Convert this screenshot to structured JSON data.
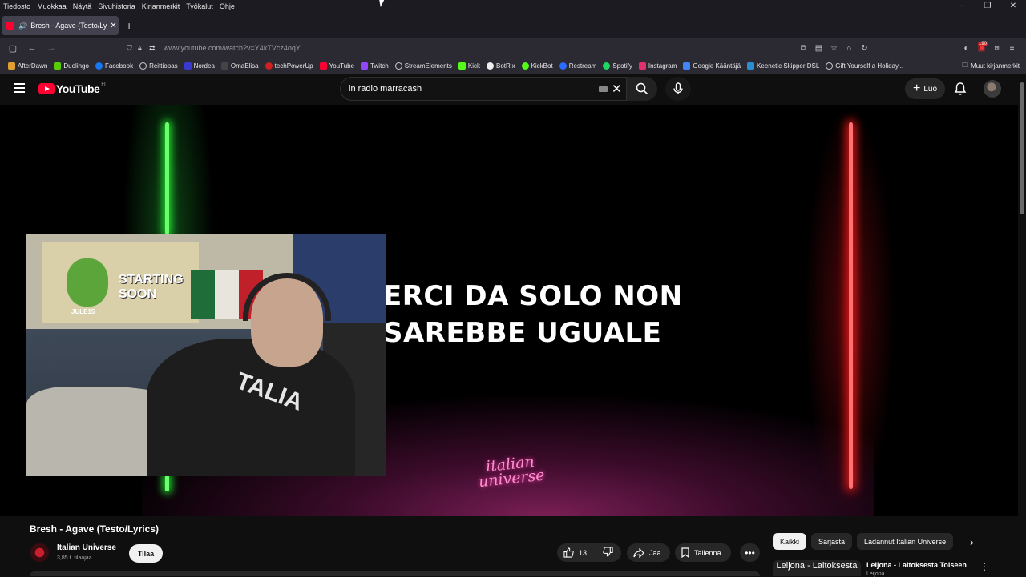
{
  "menubar": {
    "items": [
      "Tiedosto",
      "Muokkaa",
      "Näytä",
      "Sivuhistoria",
      "Kirjanmerkit",
      "Työkalut",
      "Ohje"
    ]
  },
  "tab": {
    "title": "Bresh - Agave (Testo/Lyrics)"
  },
  "urlbar": {
    "url": "www.youtube.com/watch?v=Y4kTVcz4oqY"
  },
  "badges": {
    "extension_count": "190"
  },
  "bookmarks": {
    "items": [
      {
        "label": "AfterDawn",
        "color": "#e0a030"
      },
      {
        "label": "Duolingo",
        "color": "#58cc02"
      },
      {
        "label": "Facebook",
        "color": "#1877f2"
      },
      {
        "label": "Reittiopas",
        "color": "#cccccc"
      },
      {
        "label": "Nordea",
        "color": "#0000a0"
      },
      {
        "label": "OmaElisa",
        "color": "#1a1a1a"
      },
      {
        "label": "techPowerUp",
        "color": "#d02020"
      },
      {
        "label": "YouTube",
        "color": "#ff0033"
      },
      {
        "label": "Twitch",
        "color": "#9146ff"
      },
      {
        "label": "StreamElements",
        "color": "#cccccc"
      },
      {
        "label": "Kick",
        "color": "#53fc18"
      },
      {
        "label": "BotRix",
        "color": "#ffffff"
      },
      {
        "label": "KickBot",
        "color": "#53fc18"
      },
      {
        "label": "Restream",
        "color": "#2b6bff"
      },
      {
        "label": "Spotify",
        "color": "#1ed760"
      },
      {
        "label": "Instagram",
        "color": "#e1306c"
      },
      {
        "label": "Google Kääntäjä",
        "color": "#4285f4"
      },
      {
        "label": "Keenetic Skipper DSL",
        "color": "#2a8fd0"
      },
      {
        "label": "Gift Yourself a Holiday...",
        "color": "#cccccc"
      }
    ],
    "other": "Muut kirjanmerkit"
  },
  "youtube": {
    "logo": "YouTube",
    "region": "FI",
    "search_value": "in radio marracash",
    "create_label": "Luo"
  },
  "video": {
    "lyric_line1": "ERCI DA SOLO NON",
    "lyric_line2": "SAREBBE UGUALE",
    "brand_line1": "italian",
    "brand_line2": "universe",
    "webcam_poster_line1": "STARTING",
    "webcam_poster_line2": "SOON",
    "webcam_poster_tag": "JULE15",
    "webcam_shirt_text": "TALIA"
  },
  "meta": {
    "title": "Bresh - Agave (Testo/Lyrics)",
    "channel": "Italian Universe",
    "subscribers": "3,85 t. tilaajaa",
    "subscribe_label": "Tilaa",
    "likes": "13",
    "share_label": "Jaa",
    "save_label": "Tallenna"
  },
  "chips": [
    "Kaikki",
    "Sarjasta",
    "Ladannut Italian Universe"
  ],
  "recommendation": {
    "thumb_text": "Leijona - Laitoksesta",
    "title": "Leijona - Laitoksesta Toiseen",
    "channel": "Leijona"
  }
}
